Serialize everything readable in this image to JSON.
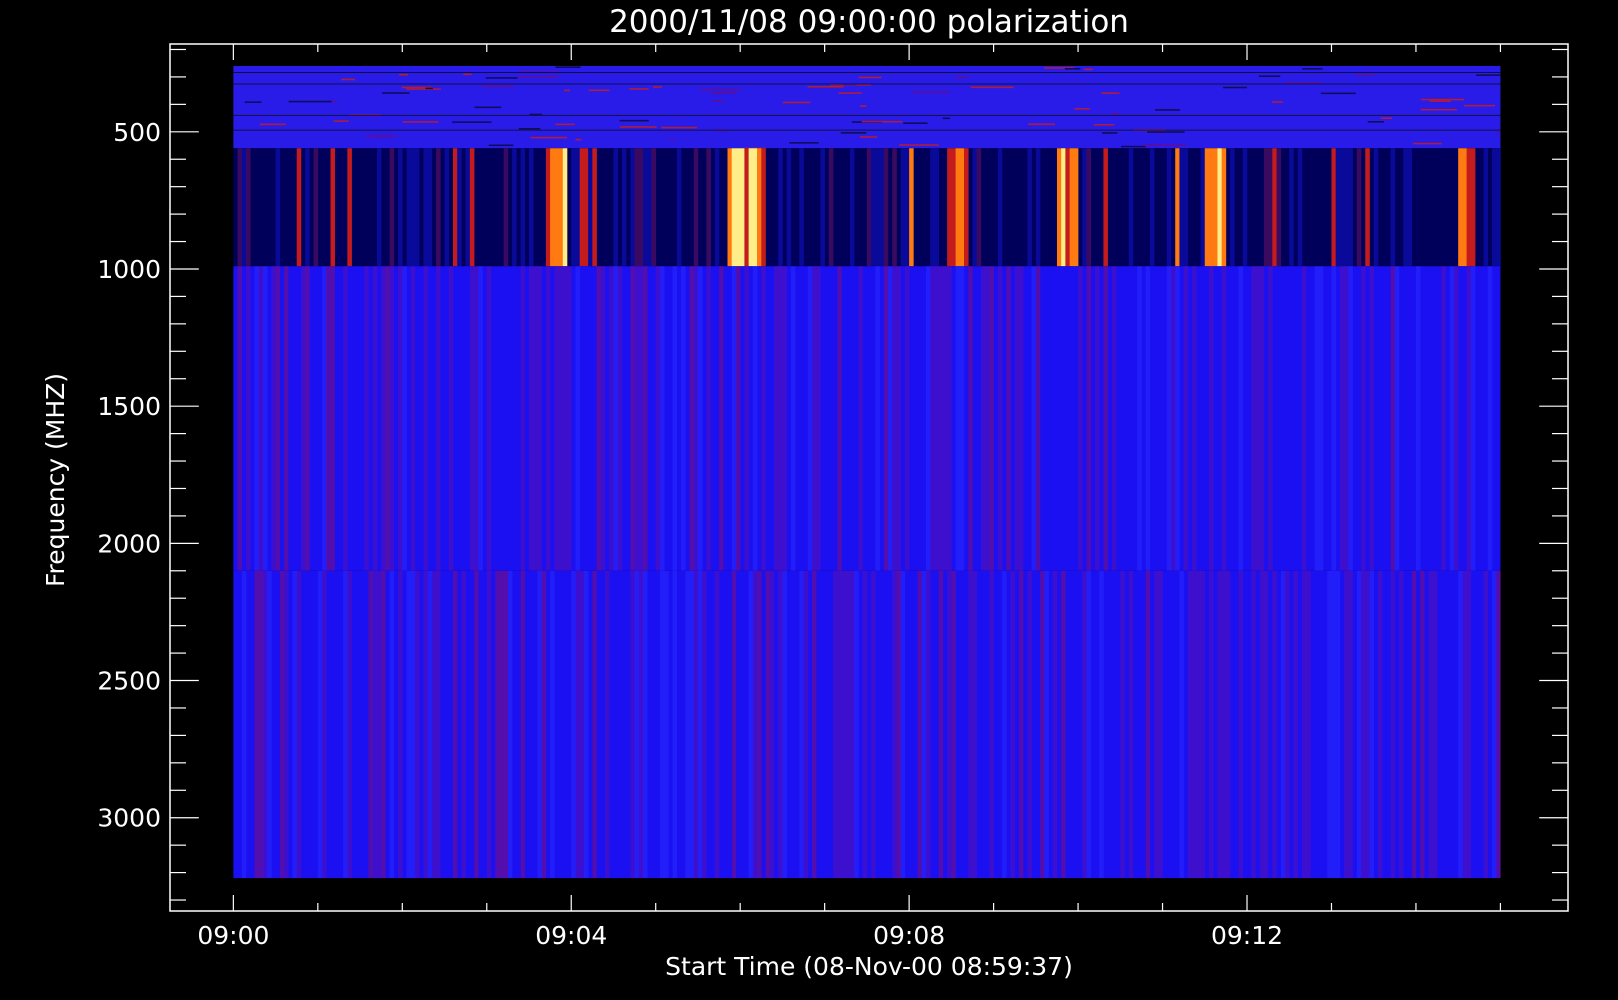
{
  "chart_data": {
    "type": "heatmap",
    "title": "2000/11/08 09:00:00 polarization",
    "xlabel": "Start Time (08-Nov-00 08:59:37)",
    "ylabel": "Frequency (MHZ)",
    "x_ticks": [
      {
        "label": "09:00",
        "minutes": 0
      },
      {
        "label": "09:04",
        "minutes": 4
      },
      {
        "label": "09:08",
        "minutes": 8
      },
      {
        "label": "09:12",
        "minutes": 12
      }
    ],
    "y_ticks": [
      500,
      1000,
      1500,
      2000,
      2500,
      3000
    ],
    "x_range_minutes": [
      -0.75,
      15.8
    ],
    "y_range_mhz": [
      180,
      3340
    ],
    "y_reversed": true,
    "data_time_range_minutes": [
      0,
      15
    ],
    "frequency_bands": [
      {
        "name": "band-1",
        "f_start_mhz": 260,
        "f_end_mhz": 560,
        "texture": "speckled",
        "base_color": "#2a1ce8"
      },
      {
        "name": "band-2",
        "f_start_mhz": 560,
        "f_end_mhz": 990,
        "texture": "stripes",
        "base_color": "#00005a"
      },
      {
        "name": "band-3",
        "f_start_mhz": 990,
        "f_end_mhz": 2100,
        "texture": "stripes",
        "base_color": "#1a10f2"
      },
      {
        "name": "band-4",
        "f_start_mhz": 2100,
        "f_end_mhz": 3220,
        "texture": "stripes",
        "base_color": "#1a10f2"
      }
    ],
    "bursts_minutes": [
      {
        "start": 3.68,
        "end": 3.97,
        "level": "high"
      },
      {
        "start": 5.85,
        "end": 6.3,
        "level": "high"
      },
      {
        "start": 7.98,
        "end": 8.05,
        "level": "medium"
      },
      {
        "start": 8.45,
        "end": 8.7,
        "level": "medium"
      },
      {
        "start": 9.75,
        "end": 10.0,
        "level": "high"
      },
      {
        "start": 11.15,
        "end": 11.2,
        "level": "medium"
      },
      {
        "start": 11.5,
        "end": 11.75,
        "level": "high"
      },
      {
        "start": 14.5,
        "end": 14.7,
        "level": "medium"
      }
    ],
    "colors": {
      "background": "#000000",
      "axes": "#ffffff",
      "low": "#00005a",
      "mid": "#1a10f2",
      "red": "#c41c1c",
      "orange": "#ff7a10",
      "yellow": "#ffee88"
    },
    "grid": false,
    "legend": "none"
  }
}
